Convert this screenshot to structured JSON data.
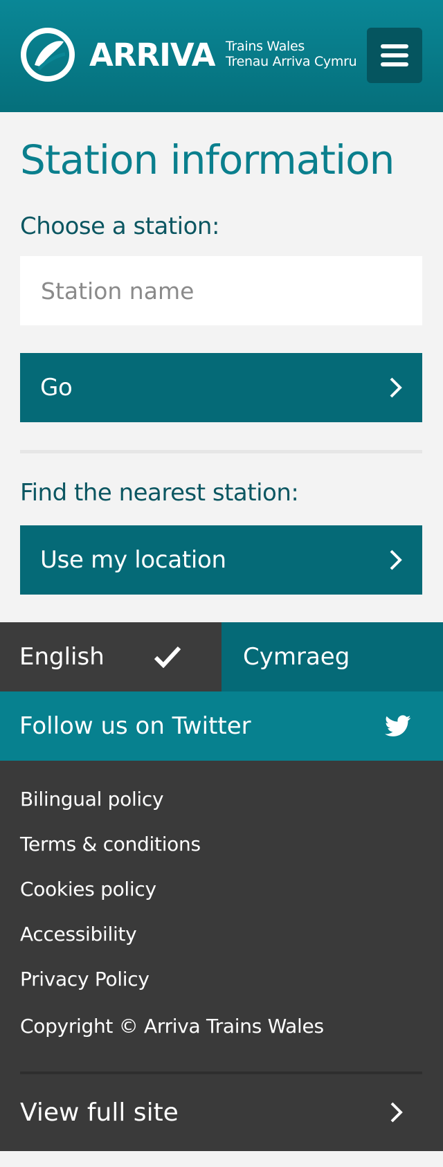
{
  "header": {
    "brand": "ARRIVA",
    "subtitle_line1": "Trains Wales",
    "subtitle_line2": "Trenau Arriva Cymru",
    "menu_icon": "hamburger-menu-icon"
  },
  "main": {
    "title": "Station information",
    "choose_label": "Choose a station:",
    "search_placeholder": "Station name",
    "go_label": "Go",
    "nearest_label": "Find the nearest station:",
    "location_label": "Use my location"
  },
  "language": {
    "english": "English",
    "cymraeg": "Cymraeg",
    "selected_icon": "checkmark-icon"
  },
  "twitter": {
    "label": "Follow us on Twitter",
    "icon": "twitter-bird-icon"
  },
  "footer": {
    "links": [
      "Bilingual policy",
      "Terms & conditions",
      "Cookies policy",
      "Accessibility",
      "Privacy Policy"
    ],
    "copyright": "Copyright © Arriva Trains Wales",
    "full_site": "View full site"
  },
  "colors": {
    "teal": "#07818f",
    "dark_teal": "#056a77",
    "dark_grey": "#3a3a3a",
    "light_bg": "#f3f3f3"
  }
}
